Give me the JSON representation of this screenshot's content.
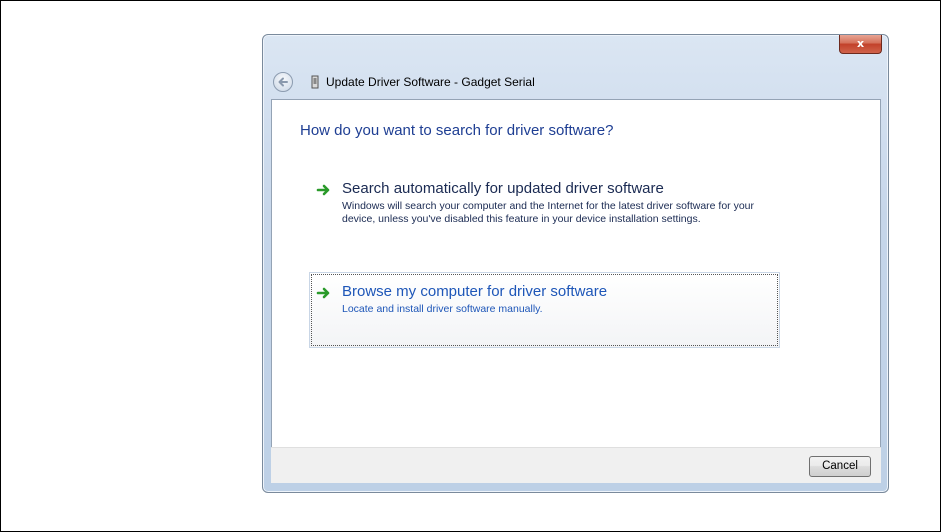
{
  "window": {
    "title": "Update Driver Software - Gadget Serial",
    "close_label": "x"
  },
  "icons": {
    "back": "back-arrow-icon",
    "device": "device-icon",
    "option_arrow": "green-arrow-icon"
  },
  "main": {
    "heading": "How do you want to search for driver software?",
    "options": [
      {
        "title": "Search automatically for updated driver software",
        "description": "Windows will search your computer and the Internet for the latest driver software for your device, unless you've disabled this feature in your device installation settings."
      },
      {
        "title": "Browse my computer for driver software",
        "description": "Locate and install driver software manually."
      }
    ]
  },
  "footer": {
    "cancel_label": "Cancel"
  },
  "colors": {
    "heading": "#1e3e93",
    "link_hover": "#1e56b8",
    "arrow_green": "#2a9a2a"
  }
}
